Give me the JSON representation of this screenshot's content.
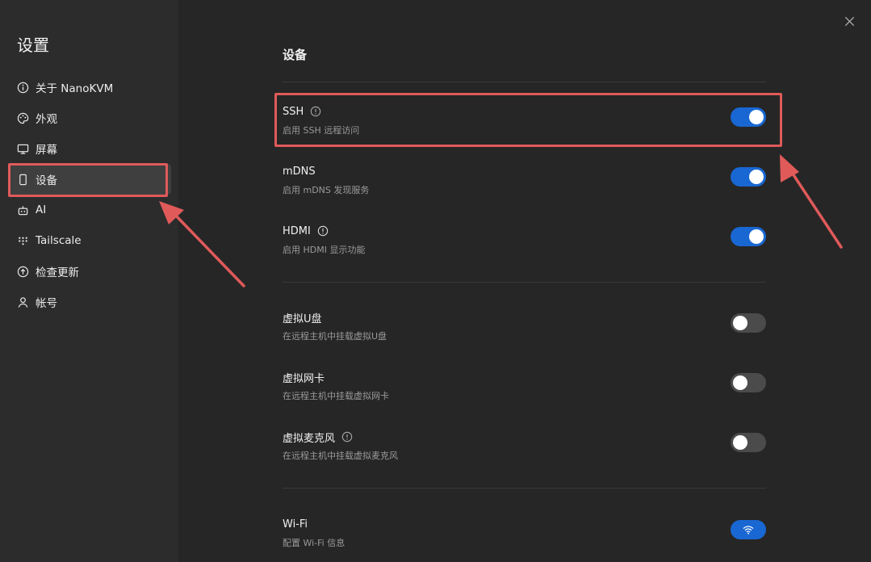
{
  "sidebar": {
    "title": "设置",
    "items": [
      {
        "label": "关于 NanoKVM",
        "icon": "info-circle-icon"
      },
      {
        "label": "外观",
        "icon": "palette-icon"
      },
      {
        "label": "屏幕",
        "icon": "monitor-icon"
      },
      {
        "label": "设备",
        "icon": "phone-device-icon",
        "active": true
      },
      {
        "label": "AI",
        "icon": "robot-icon"
      },
      {
        "label": "Tailscale",
        "icon": "tailscale-dots-icon"
      },
      {
        "label": "检查更新",
        "icon": "arrow-up-circle-icon"
      },
      {
        "label": "帐号",
        "icon": "user-icon"
      }
    ]
  },
  "main": {
    "section_title": "设备",
    "settings": [
      {
        "label": "SSH",
        "desc": "启用 SSH 远程访问",
        "on": true,
        "info": true
      },
      {
        "label": "mDNS",
        "desc": "启用 mDNS 发现服务",
        "on": true,
        "info": false
      },
      {
        "label": "HDMI",
        "desc": "启用 HDMI 显示功能",
        "on": true,
        "info": true
      },
      {
        "label": "虚拟U盘",
        "desc": "在远程主机中挂载虚拟U盘",
        "on": false,
        "info": false
      },
      {
        "label": "虚拟网卡",
        "desc": "在远程主机中挂载虚拟网卡",
        "on": false,
        "info": false
      },
      {
        "label": "虚拟麦克风",
        "desc": "在远程主机中挂载虚拟麦克风",
        "on": false,
        "info": true
      },
      {
        "label": "Wi-Fi",
        "desc": "配置 Wi-Fi 信息",
        "icon": "wifi-icon"
      }
    ]
  },
  "colors": {
    "accent": "#1967d2",
    "highlight": "#e05a5a",
    "sidebar_bg": "#2c2c2c",
    "main_bg": "#262626"
  }
}
